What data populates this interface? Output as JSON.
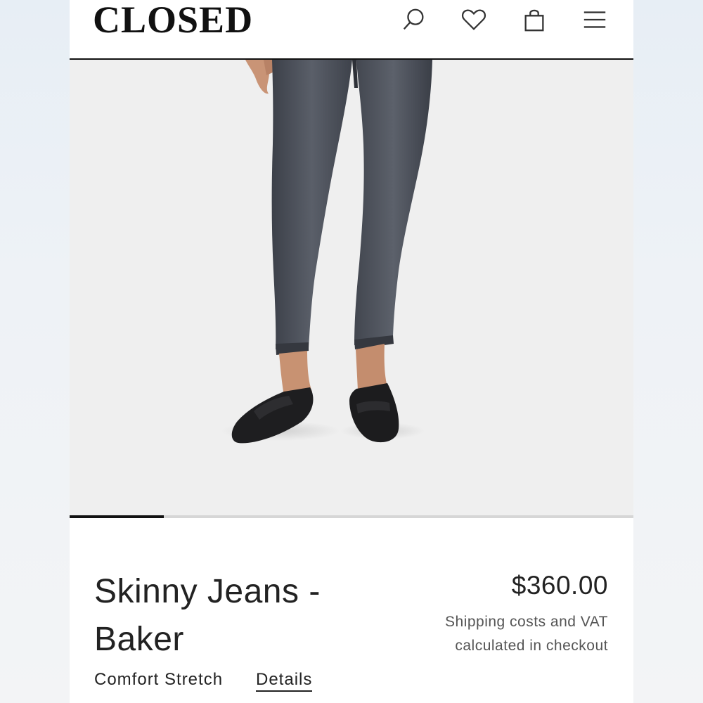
{
  "header": {
    "logo_text": "CLOSED",
    "icons": [
      "search-icon",
      "heart-icon",
      "shopping-bag-icon",
      "menu-icon"
    ]
  },
  "gallery": {
    "image_subject": "Skinny Jeans - Baker",
    "progress_fraction": 0.167
  },
  "product": {
    "title": "Skinny Jeans - Baker",
    "price": "$360.00",
    "shipping_note": "Shipping costs and VAT calculated in checkout",
    "fit_label": "Comfort Stretch",
    "details_link": "Details"
  },
  "colors": {
    "text": "#222222",
    "muted": "#555555",
    "image_bg": "#efefef",
    "denim": "#4a4f58"
  }
}
